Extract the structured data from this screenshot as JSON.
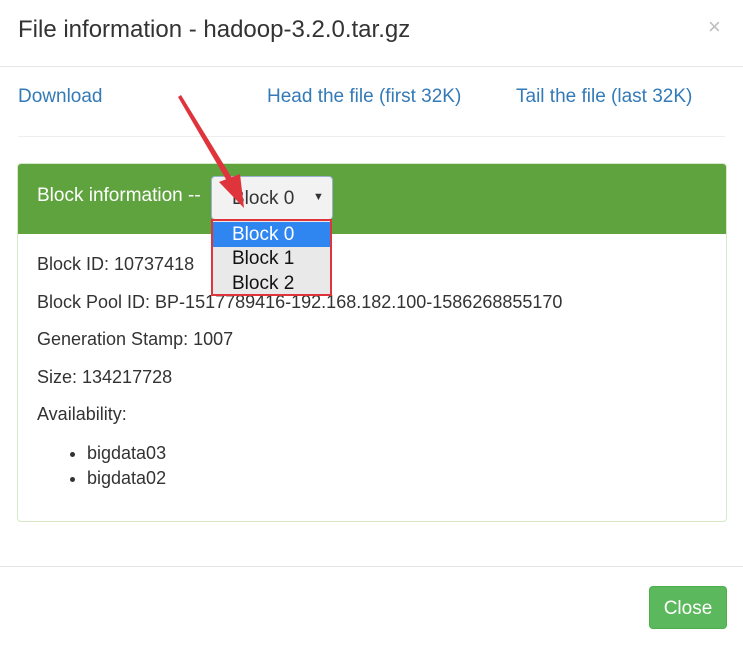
{
  "header": {
    "title": "File information - hadoop-3.2.0.tar.gz",
    "close_glyph": "×"
  },
  "links": {
    "download": "Download",
    "head": "Head the file (first 32K)",
    "tail": "Tail the file (last 32K)"
  },
  "panel": {
    "heading": "Block information --",
    "select": {
      "value": "Block 0",
      "options": [
        "Block 0",
        "Block 1",
        "Block 2"
      ],
      "caret": "▼"
    },
    "info": {
      "block_id": "Block ID: 10737418",
      "block_pool_id": "Block Pool ID: BP-1517789416-192.168.182.100-1586268855170",
      "generation_stamp": "Generation Stamp: 1007",
      "size": "Size: 134217728",
      "availability_label": "Availability:",
      "availability": [
        "bigdata03",
        "bigdata02"
      ]
    }
  },
  "footer": {
    "close_label": "Close"
  },
  "colors": {
    "panel_heading": "#5fa33e",
    "link": "#337ab7",
    "annotation": "#e0343c",
    "selected_option": "#2f86f0",
    "close_button": "#5cb85c"
  }
}
